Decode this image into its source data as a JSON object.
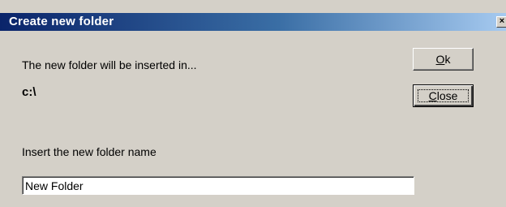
{
  "window": {
    "title": "Create new folder",
    "close_glyph": "×",
    "titlebar_gradient": [
      "#0a246a",
      "#3a6ea5",
      "#a6caf0"
    ],
    "face_color": "#d4d0c8"
  },
  "labels": {
    "inserted_in": "The new folder will be inserted in...",
    "target_path": "c:\\",
    "insert_name": "Insert the new folder name"
  },
  "buttons": {
    "ok": {
      "mnemonic": "O",
      "rest": "k"
    },
    "close": {
      "mnemonic": "C",
      "rest": "lose"
    }
  },
  "folder_name_input": {
    "value": "New Folder"
  }
}
